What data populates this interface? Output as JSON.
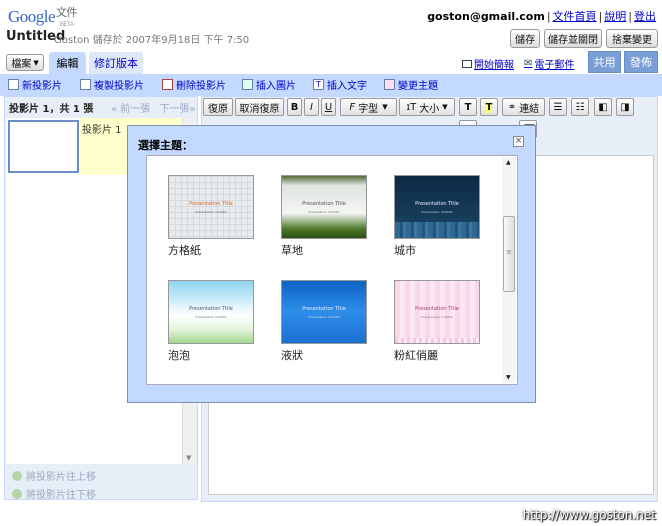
{
  "header": {
    "logo_text": "Google",
    "logo_product": "文件",
    "logo_beta": "BETA",
    "user_email": "goston@gmail.com",
    "links": [
      "文件首頁",
      "說明",
      "登出"
    ],
    "doc_title": "Untitled",
    "save_status": "Goston 儲存於 2007年9月18日 下午 7:50",
    "buttons": {
      "save": "儲存",
      "save_close": "儲存並關閉",
      "discard": "捨棄變更"
    }
  },
  "tabs": {
    "file_menu": "檔案",
    "edit": "編輯",
    "revisions": "修訂版本"
  },
  "top_right": {
    "present": "開始簡報",
    "email": "電子郵件",
    "share": "共用",
    "publish": "發佈"
  },
  "actions": [
    "新投影片",
    "複製投影片",
    "刪除投影片",
    "插入圖片",
    "插入文字",
    "變更主題"
  ],
  "left_panel": {
    "slide_count": "投影片 1，共 1 張",
    "prev": "« 前一張",
    "next": "下一張»",
    "slide_label": "投影片 1",
    "move_up": "將投影片往上移",
    "move_down": "將投影片往下移"
  },
  "toolbar": {
    "undo": "復原",
    "redo": "取消復原",
    "bold": "B",
    "italic": "I",
    "underline": "U",
    "font": "字型",
    "size": "大小",
    "link": "連結"
  },
  "modal": {
    "title": "選擇主題：",
    "close": "×",
    "themes": [
      {
        "name": "方格紙",
        "title": "Presentation Title",
        "subtitle": "Presentation Subtitle"
      },
      {
        "name": "草地",
        "title": "Presentation Title",
        "subtitle": "Presentation Subtitle"
      },
      {
        "name": "城市",
        "title": "Presentation Title",
        "subtitle": "Presentation Subtitle"
      },
      {
        "name": "泡泡",
        "title": "Presentation Title",
        "subtitle": "Presentation Subtitle"
      },
      {
        "name": "液狀",
        "title": "Presentation Title",
        "subtitle": "Presentation Subtitle"
      },
      {
        "name": "粉紅俏麗",
        "title": "Presentation Title",
        "subtitle": "Presentation Subtitle"
      }
    ]
  },
  "watermark": "http://www.goston.net",
  "colors": {
    "accent": "#c3d9ff",
    "link": "#0000cc",
    "share_button": "#7a9fd6"
  }
}
